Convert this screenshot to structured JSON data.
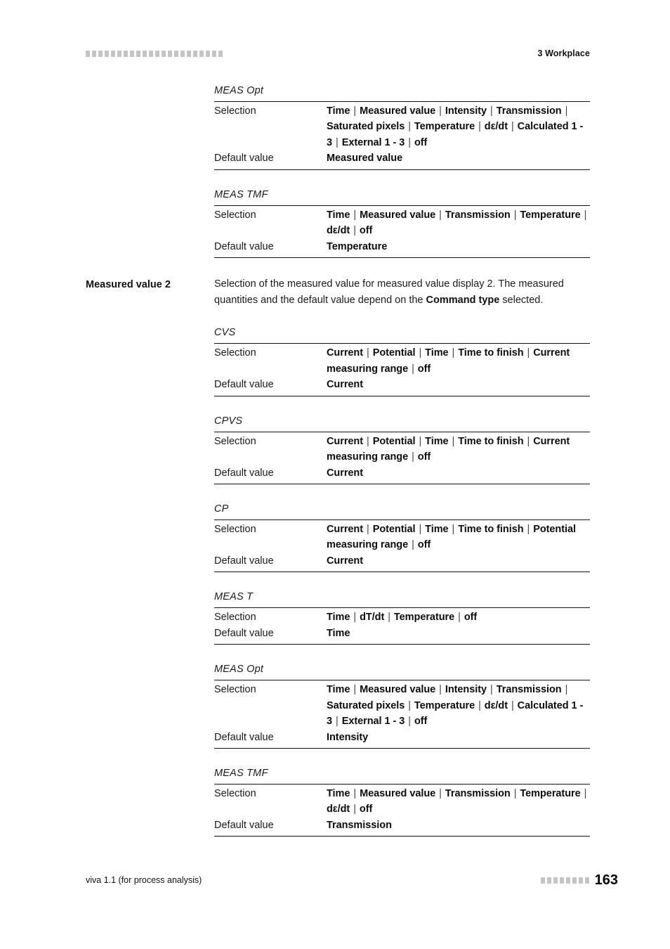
{
  "header": {
    "decoration_icon": "square-dot-rule",
    "decoration_squares": 22,
    "title": "3 Workplace"
  },
  "footer": {
    "product": "viva 1.1 (for process analysis)",
    "decoration_icon": "square-dot-rule",
    "decoration_squares": 8,
    "page_number": "163"
  },
  "sections": [
    {
      "margin_label": "",
      "tables": [
        {
          "caption": "MEAS Opt",
          "rows": [
            {
              "key": "Selection",
              "value": "Time | Measured value | Intensity | Transmission | Saturated pixels | Temperature | dε/dt | Calculated 1 - 3 | External 1 - 3 | off"
            },
            {
              "key": "Default value",
              "value": "Measured value"
            }
          ]
        },
        {
          "caption": "MEAS TMF",
          "rows": [
            {
              "key": "Selection",
              "value": "Time | Measured value | Transmission | Temperature | dε/dt | off"
            },
            {
              "key": "Default value",
              "value": "Temperature"
            }
          ]
        }
      ]
    },
    {
      "margin_label": "Measured value 2",
      "paragraph_parts": [
        {
          "text": "Selection of the measured value for measured value display 2. The measured quantities and the default value depend on the ",
          "bold": false
        },
        {
          "text": "Command type",
          "bold": true
        },
        {
          "text": " selected.",
          "bold": false
        }
      ],
      "tables": [
        {
          "caption": "CVS",
          "rows": [
            {
              "key": "Selection",
              "value": "Current | Potential | Time | Time to finish | Current measuring range | off"
            },
            {
              "key": "Default value",
              "value": "Current"
            }
          ]
        },
        {
          "caption": "CPVS",
          "rows": [
            {
              "key": "Selection",
              "value": "Current | Potential | Time | Time to finish | Current measuring range | off"
            },
            {
              "key": "Default value",
              "value": "Current"
            }
          ]
        },
        {
          "caption": "CP",
          "rows": [
            {
              "key": "Selection",
              "value": "Current | Potential | Time | Time to finish | Potential measuring range | off"
            },
            {
              "key": "Default value",
              "value": "Current"
            }
          ]
        },
        {
          "caption": "MEAS T",
          "rows": [
            {
              "key": "Selection",
              "value": "Time | dT/dt | Temperature | off"
            },
            {
              "key": "Default value",
              "value": "Time"
            }
          ]
        },
        {
          "caption": "MEAS Opt",
          "rows": [
            {
              "key": "Selection",
              "value": "Time | Measured value | Intensity | Transmission | Saturated pixels | Temperature | dε/dt | Calculated 1 - 3 | External 1 - 3 | off"
            },
            {
              "key": "Default value",
              "value": "Intensity"
            }
          ]
        },
        {
          "caption": "MEAS TMF",
          "rows": [
            {
              "key": "Selection",
              "value": "Time | Measured value | Transmission | Temperature | dε/dt | off"
            },
            {
              "key": "Default value",
              "value": "Transmission"
            }
          ]
        }
      ]
    }
  ]
}
